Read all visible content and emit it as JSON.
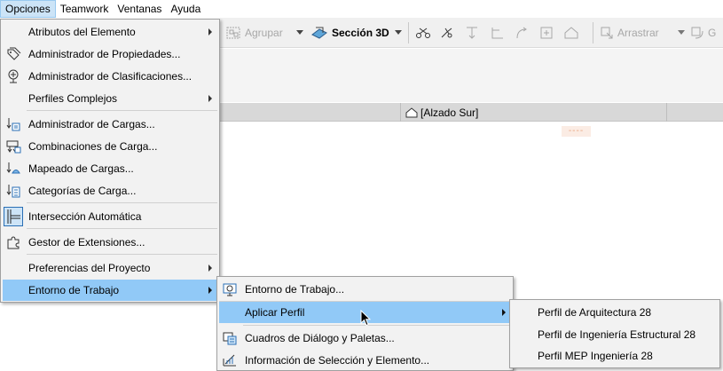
{
  "menubar": {
    "items": [
      {
        "label": "Opciones"
      },
      {
        "label": "Teamwork"
      },
      {
        "label": "Ventanas"
      },
      {
        "label": "Ayuda"
      }
    ]
  },
  "toolbar": {
    "group_label": "Agrupar",
    "section3d_label": "Sección 3D",
    "drag_label": "Arrastrar",
    "cut_label": "G"
  },
  "view_tab": {
    "label": "[Alzado Sur]"
  },
  "marker": {
    "text": "----"
  },
  "options_menu": {
    "items": [
      {
        "label": "Atributos del Elemento",
        "icon": "none",
        "submenu": true
      },
      {
        "label": "Administrador de Propiedades...",
        "icon": "tag-icon"
      },
      {
        "label": "Administrador de Clasificaciones...",
        "icon": "classification-icon"
      },
      {
        "label": "Perfiles Complejos",
        "icon": "none",
        "submenu": true
      },
      {
        "label": "Administrador de Cargas...",
        "icon": "load-manager-icon"
      },
      {
        "label": "Combinaciones de Carga...",
        "icon": "load-combination-icon"
      },
      {
        "label": "Mapeado de Cargas...",
        "icon": "load-mapping-icon"
      },
      {
        "label": "Categorías de Carga...",
        "icon": "load-category-icon"
      },
      {
        "label": "Intersección Automática",
        "icon": "auto-intersection-icon",
        "checked": true
      },
      {
        "label": "Gestor de Extensiones...",
        "icon": "puzzle-icon"
      },
      {
        "label": "Preferencias del Proyecto",
        "icon": "none",
        "submenu": true
      },
      {
        "label": "Entorno de Trabajo",
        "icon": "none",
        "submenu": true,
        "highlighted": true
      }
    ]
  },
  "work_env_menu": {
    "items": [
      {
        "label": "Entorno de Trabajo...",
        "icon": "work-environment-icon"
      },
      {
        "label": "Aplicar Perfil",
        "icon": "none",
        "submenu": true,
        "highlighted": true
      },
      {
        "label": "Cuadros de Diálogo y Paletas...",
        "icon": "dialogs-palettes-icon"
      },
      {
        "label": "Información de Selección y Elemento...",
        "icon": "selection-info-icon"
      }
    ]
  },
  "profile_menu": {
    "items": [
      {
        "label": "Perfil de Arquitectura 28"
      },
      {
        "label": "Perfil de Ingeniería Estructural 28"
      },
      {
        "label": "Perfil MEP Ingeniería 28"
      }
    ]
  },
  "colors": {
    "highlight": "#91c9f7",
    "menu_bg": "#f2f2f2",
    "menubar_active": "#cce4f7"
  }
}
